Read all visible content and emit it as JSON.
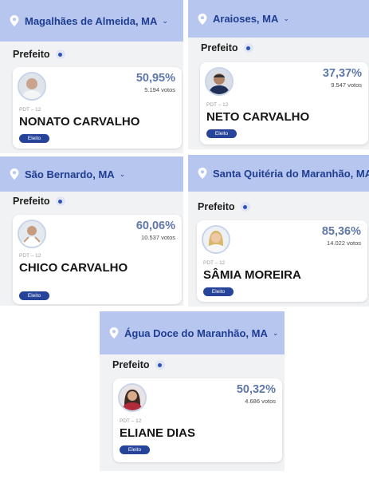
{
  "results": [
    {
      "municipality": "Magalhães de Almeida, MA",
      "office": "Prefeito",
      "percent": "50,95%",
      "votes": "5.194 votos",
      "party": "PDT – 12",
      "name": "NONATO CARVALHO",
      "status": "Eleito",
      "icon": "candidate-photo"
    },
    {
      "municipality": "Araioses, MA",
      "office": "Prefeito",
      "percent": "37,37%",
      "votes": "9.547 votos",
      "party": "PDT – 12",
      "name": "NETO CARVALHO",
      "status": "Eleito",
      "icon": "candidate-photo"
    },
    {
      "municipality": "São Bernardo, MA",
      "office": "Prefeito",
      "percent": "60,06%",
      "votes": "10.537 votos",
      "party": "PDT – 12",
      "name": "CHICO CARVALHO",
      "status": "Eleito",
      "icon": "candidate-photo"
    },
    {
      "municipality": "Santa Quitéria do Maranhão, MA",
      "office": "Prefeito",
      "percent": "85,36%",
      "votes": "14.022 votos",
      "party": "PDT – 12",
      "name": "SÂMIA MOREIRA",
      "status": "Eleito",
      "icon": "candidate-photo"
    },
    {
      "municipality": "Água Doce do Maranhão, MA",
      "office": "Prefeito",
      "percent": "50,32%",
      "votes": "4.686 votos",
      "party": "PDT – 12",
      "name": "ELIANE DIAS",
      "status": "Eleito",
      "icon": "candidate-photo"
    }
  ],
  "colors": {
    "header": "#b6c6ee",
    "accent": "#1f3d92",
    "percent": "#5f78a8",
    "badge": "#26449a"
  }
}
